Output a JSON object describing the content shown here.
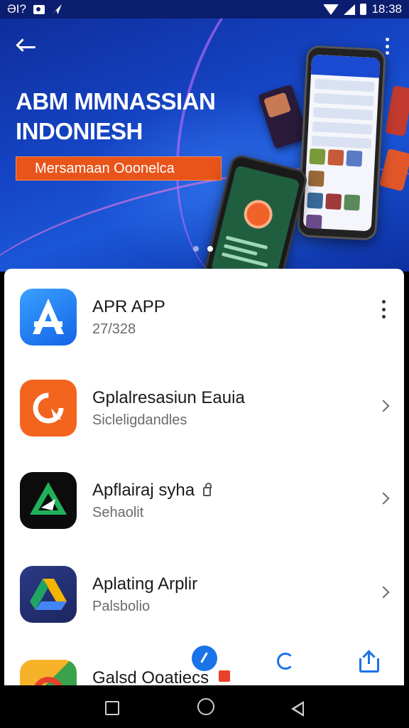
{
  "status_bar": {
    "left_text": "ƏI?",
    "time": "18:38"
  },
  "banner": {
    "title_line1": "ABM MMNASSIAN",
    "title_line2": "INDONIESH",
    "cta_label": "Mersamaan Ooonelca",
    "active_slide": 2,
    "slide_count": 2
  },
  "apps": [
    {
      "title": "APR APP",
      "subtitle": "27/328",
      "trailing": "more-menu",
      "icon": "app-a-icon"
    },
    {
      "title": "Gplalresasiun Eauia",
      "subtitle": "Sicleligdandles",
      "trailing": "chevron",
      "icon": "orange-refresh-icon"
    },
    {
      "title": "Apflairaj syha",
      "subtitle": "Sehaolit",
      "trailing": "chevron",
      "icon": "green-triangle-icon",
      "badge": "lock"
    },
    {
      "title": "Aplating Arplir",
      "subtitle": "Palsbolio",
      "trailing": "chevron",
      "icon": "drive-icon"
    },
    {
      "title": "Galsd Ooatiecs",
      "subtitle": "",
      "trailing": "none",
      "icon": "photos-icon",
      "badge": "red-square"
    }
  ],
  "colors": {
    "accent": "#1a73e8",
    "banner_cta": "#e8541a",
    "banner_bg": "#1544c4"
  }
}
